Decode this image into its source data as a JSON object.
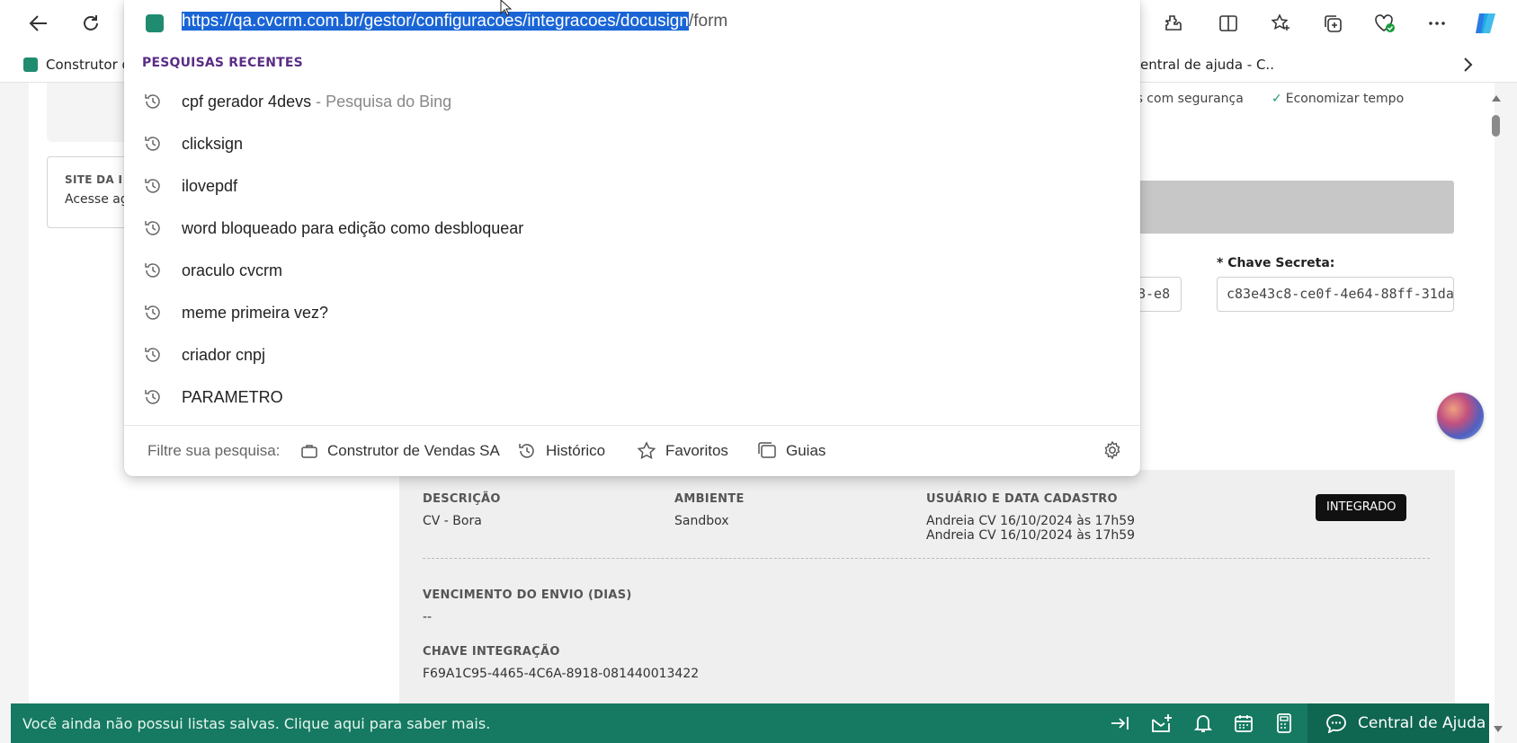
{
  "browser": {
    "toolbar_icons": [
      "back-icon",
      "refresh-icon",
      "extensions-icon",
      "split-screen-icon",
      "favorites-icon",
      "collections-icon",
      "browser-essentials-icon",
      "more-icon",
      "copilot-icon"
    ],
    "bookmarks": [
      {
        "label": "Construtor d",
        "icon": "cv-favicon"
      },
      {
        "label": "entral de ajuda - C...",
        "icon": ""
      }
    ],
    "bookmarks_more_icon": "chevron-right-icon"
  },
  "address_dropdown": {
    "url_selected": "https://qa.cvcrm.com.br/gestor/configuracoes/integracoes/docusign",
    "url_rest": "/form",
    "recent_header": "PESQUISAS RECENTES",
    "suggestions": [
      {
        "text": "cpf gerador 4devs",
        "sub": " - Pesquisa do Bing"
      },
      {
        "text": "clicksign",
        "sub": ""
      },
      {
        "text": "ilovepdf",
        "sub": ""
      },
      {
        "text": "word bloqueado para edição como desbloquear",
        "sub": ""
      },
      {
        "text": "oraculo cvcrm",
        "sub": ""
      },
      {
        "text": "meme primeira vez?",
        "sub": ""
      },
      {
        "text": "criador cnpj",
        "sub": ""
      },
      {
        "text": "PARAMETRO",
        "sub": ""
      }
    ],
    "filter_label": "Filtre sua pesquisa:",
    "filters": [
      {
        "label": "Construtor de Vendas SA",
        "icon": "briefcase-icon"
      },
      {
        "label": "Histórico",
        "icon": "history-icon"
      },
      {
        "label": "Favoritos",
        "icon": "star-icon"
      },
      {
        "label": "Guias",
        "icon": "tabs-icon"
      }
    ]
  },
  "page": {
    "site_box": {
      "title": "SITE DA I",
      "text": "Acesse ag"
    },
    "checks": [
      "os com segurança",
      "Economizar tempo"
    ],
    "secret_key": {
      "label": "* Chave Secreta:",
      "value": "c83e43c8-ce0f-4e64-88ff-31da",
      "left_value": "8-e8"
    },
    "detail": {
      "descricao_label": "DESCRIÇÃO",
      "descricao_value": "CV - Bora",
      "ambiente_label": "AMBIENTE",
      "ambiente_value": "Sandbox",
      "usuario_label": "USUÁRIO E DATA CADASTRO",
      "usuario_line1": "Andreia CV 16/10/2024 às 17h59",
      "usuario_line2": "Andreia CV 16/10/2024 às 17h59",
      "status_badge": "INTEGRADO",
      "vencimento_label": "VENCIMENTO DO ENVIO (DIAS)",
      "vencimento_value": "--",
      "chave_label": "CHAVE INTEGRAÇÃO",
      "chave_value": "F69A1C95-4465-4C6A-8918-081440013422"
    }
  },
  "bottom_bar": {
    "message": "Você ainda não possui listas salvas. Clique aqui para saber mais.",
    "icons": [
      "expand-icon",
      "mail-icon",
      "bell-icon",
      "calendar-icon",
      "calculator-icon"
    ],
    "help_label": "Central de Ajuda"
  },
  "colors": {
    "accent_green": "#157a61",
    "selection_blue": "#1a65d6",
    "recent_purple": "#5a2d86"
  }
}
